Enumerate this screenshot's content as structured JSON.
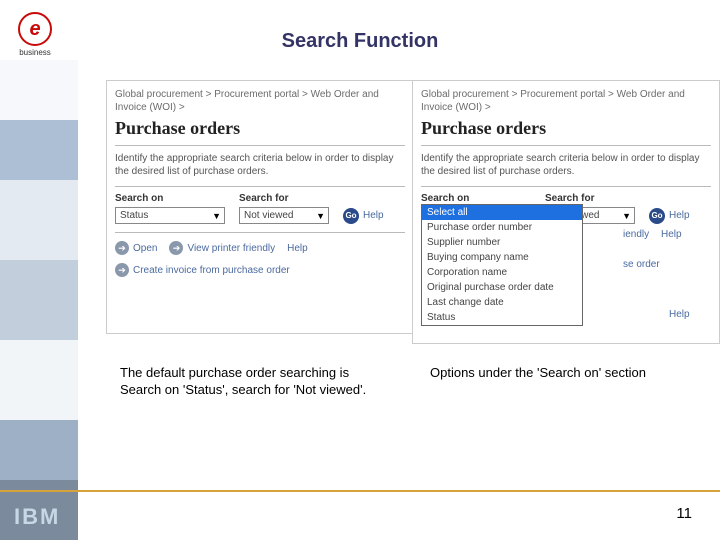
{
  "logo": {
    "glyph": "e",
    "label": "business"
  },
  "title": "Search Function",
  "crumbs": "Global procurement > Procurement portal > Web Order and Invoice (WOI) >",
  "page_heading": "Purchase orders",
  "intro": "Identify the appropriate search criteria below in order to display the desired list of purchase orders.",
  "labels": {
    "search_on": "Search on",
    "search_for": "Search for",
    "go": "Go",
    "help": "Help"
  },
  "left": {
    "search_on_value": "Status",
    "search_for_value": "Not viewed",
    "actions": {
      "open": "Open",
      "printer": "View printer friendly",
      "help": "Help",
      "invoice": "Create invoice from purchase order"
    }
  },
  "right": {
    "search_on_value": "Status",
    "search_for_value": "Not viewed",
    "options": [
      "Select all",
      "Purchase order number",
      "Supplier number",
      "Buying company name",
      "Corporation name",
      "Original purchase order date",
      "Last change date",
      "Status"
    ],
    "peek": {
      "friendly": "iendly",
      "help1": "Help",
      "order": "se order",
      "help2": "Help"
    }
  },
  "captions": {
    "left": "The default purchase order searching is Search on 'Status', search for 'Not viewed'.",
    "right": "Options under the 'Search on' section"
  },
  "ibm": "IBM",
  "page_number": "11"
}
